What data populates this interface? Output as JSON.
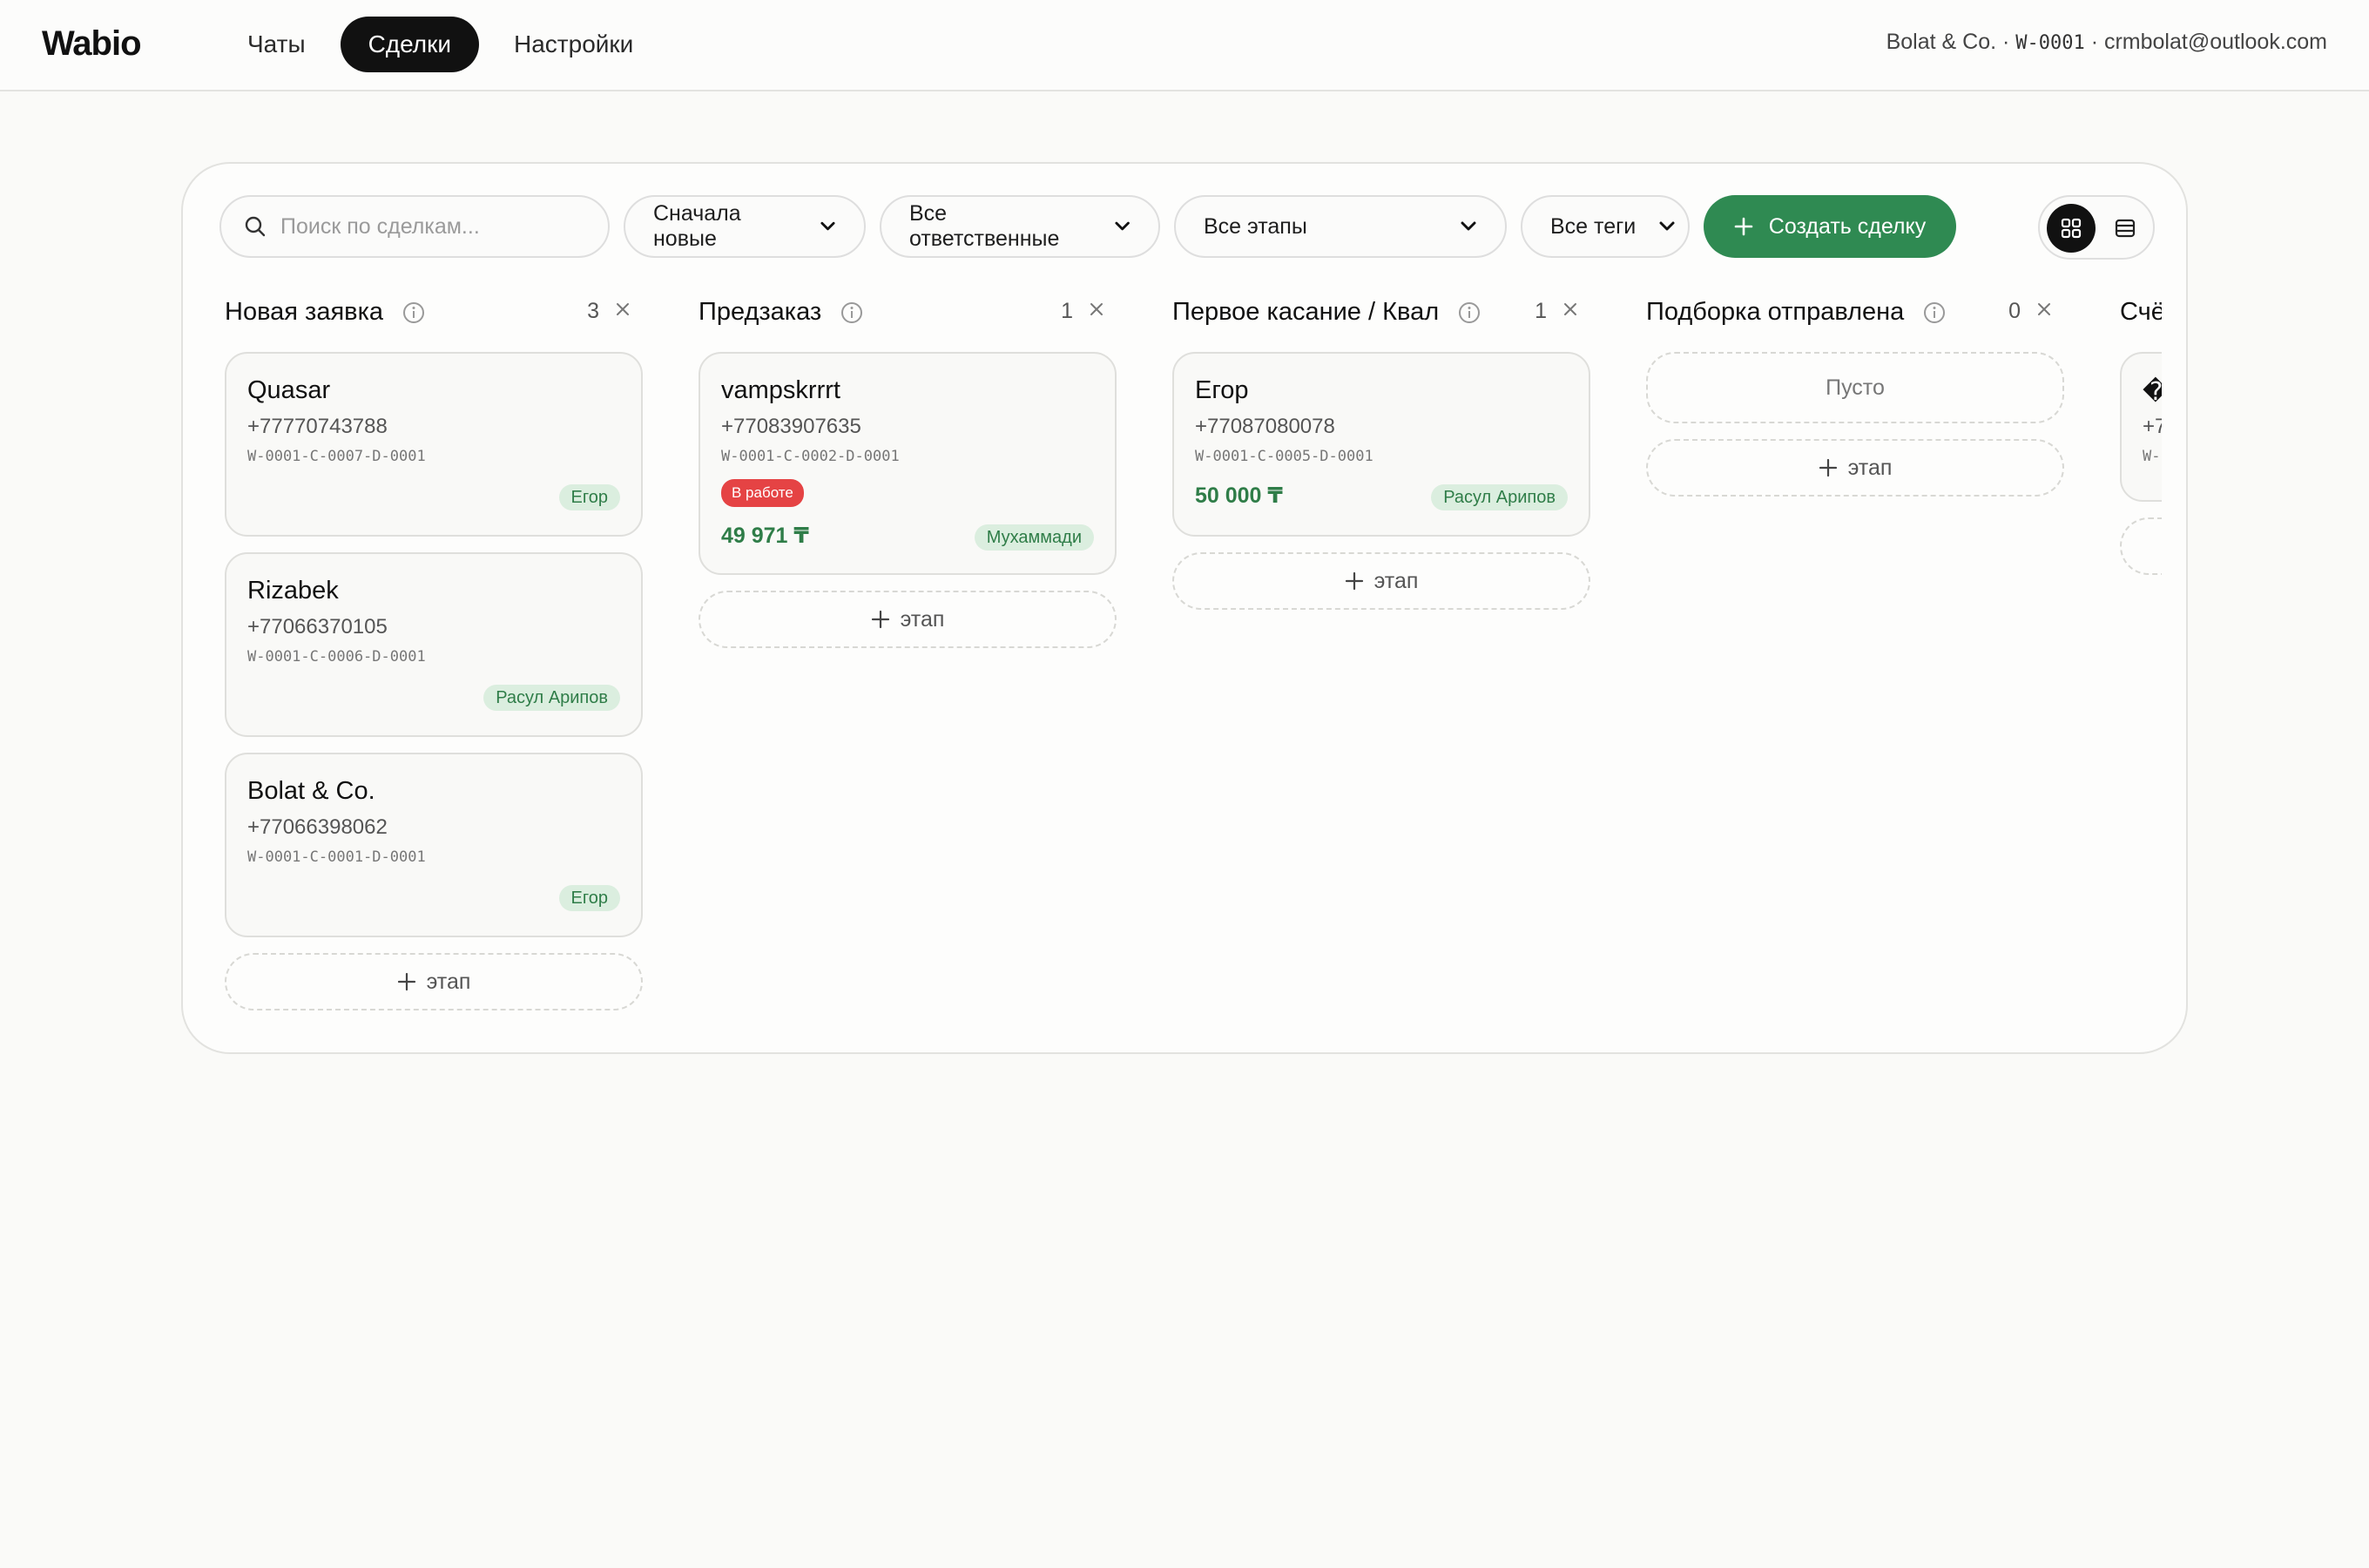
{
  "app": {
    "logo": "Wabio",
    "nav": [
      {
        "label": "Чаты"
      },
      {
        "label": "Сделки"
      },
      {
        "label": "Настройки"
      }
    ],
    "account": {
      "company": "Bolat & Co.",
      "sep1": " · ",
      "workspace_id": "W-0001",
      "sep2": " · ",
      "email": "crmbolat@outlook.com"
    }
  },
  "toolbar": {
    "search_placeholder": "Поиск по сделкам...",
    "sort_selected": "Сначала новые",
    "assignee_selected": "Все ответственные",
    "stage_selected": "Все этапы",
    "tags_selected": "Все теги",
    "create_label": "Создать сделку",
    "view_modes": [
      "grid-icon",
      "list-icon"
    ]
  },
  "colors": {
    "accent_green": "#2f8a52",
    "assignee_badge_bg": "#dbeedf",
    "status_red": "#e54344"
  },
  "board": {
    "add_stage_label": "этап",
    "empty_label": "Пусто",
    "columns": [
      {
        "title": "Новая заявка",
        "count": "3",
        "deals": [
          {
            "name": "Quasar",
            "phone": "+77770743788",
            "code": "W-0001-C-0007-D-0001",
            "assignee": "Егор"
          },
          {
            "name": "Rizabek",
            "phone": "+77066370105",
            "code": "W-0001-C-0006-D-0001",
            "assignee": "Расул Арипов"
          },
          {
            "name": "Bolat & Co.",
            "phone": "+77066398062",
            "code": "W-0001-C-0001-D-0001",
            "assignee": "Егор"
          }
        ]
      },
      {
        "title": "Предзаказ",
        "count": "1",
        "deals": [
          {
            "name": "vampskrrrt",
            "phone": "+77083907635",
            "code": "W-0001-C-0002-D-0001",
            "status": "В работе",
            "amount": "49 971 ₸",
            "assignee": "Мухаммади"
          }
        ]
      },
      {
        "title": "Первое касание / Квал",
        "count": "1",
        "deals": [
          {
            "name": "Егор",
            "phone": "+77087080078",
            "code": "W-0001-C-0005-D-0001",
            "amount": "50 000 ₸",
            "assignee": "Расул Арипов"
          }
        ]
      },
      {
        "title": "Подборка отправлена",
        "count": "0",
        "deals": []
      },
      {
        "title": "Счё",
        "partial_card": {
          "name": "�",
          "phone": "+7",
          "code": "W-"
        }
      }
    ]
  }
}
